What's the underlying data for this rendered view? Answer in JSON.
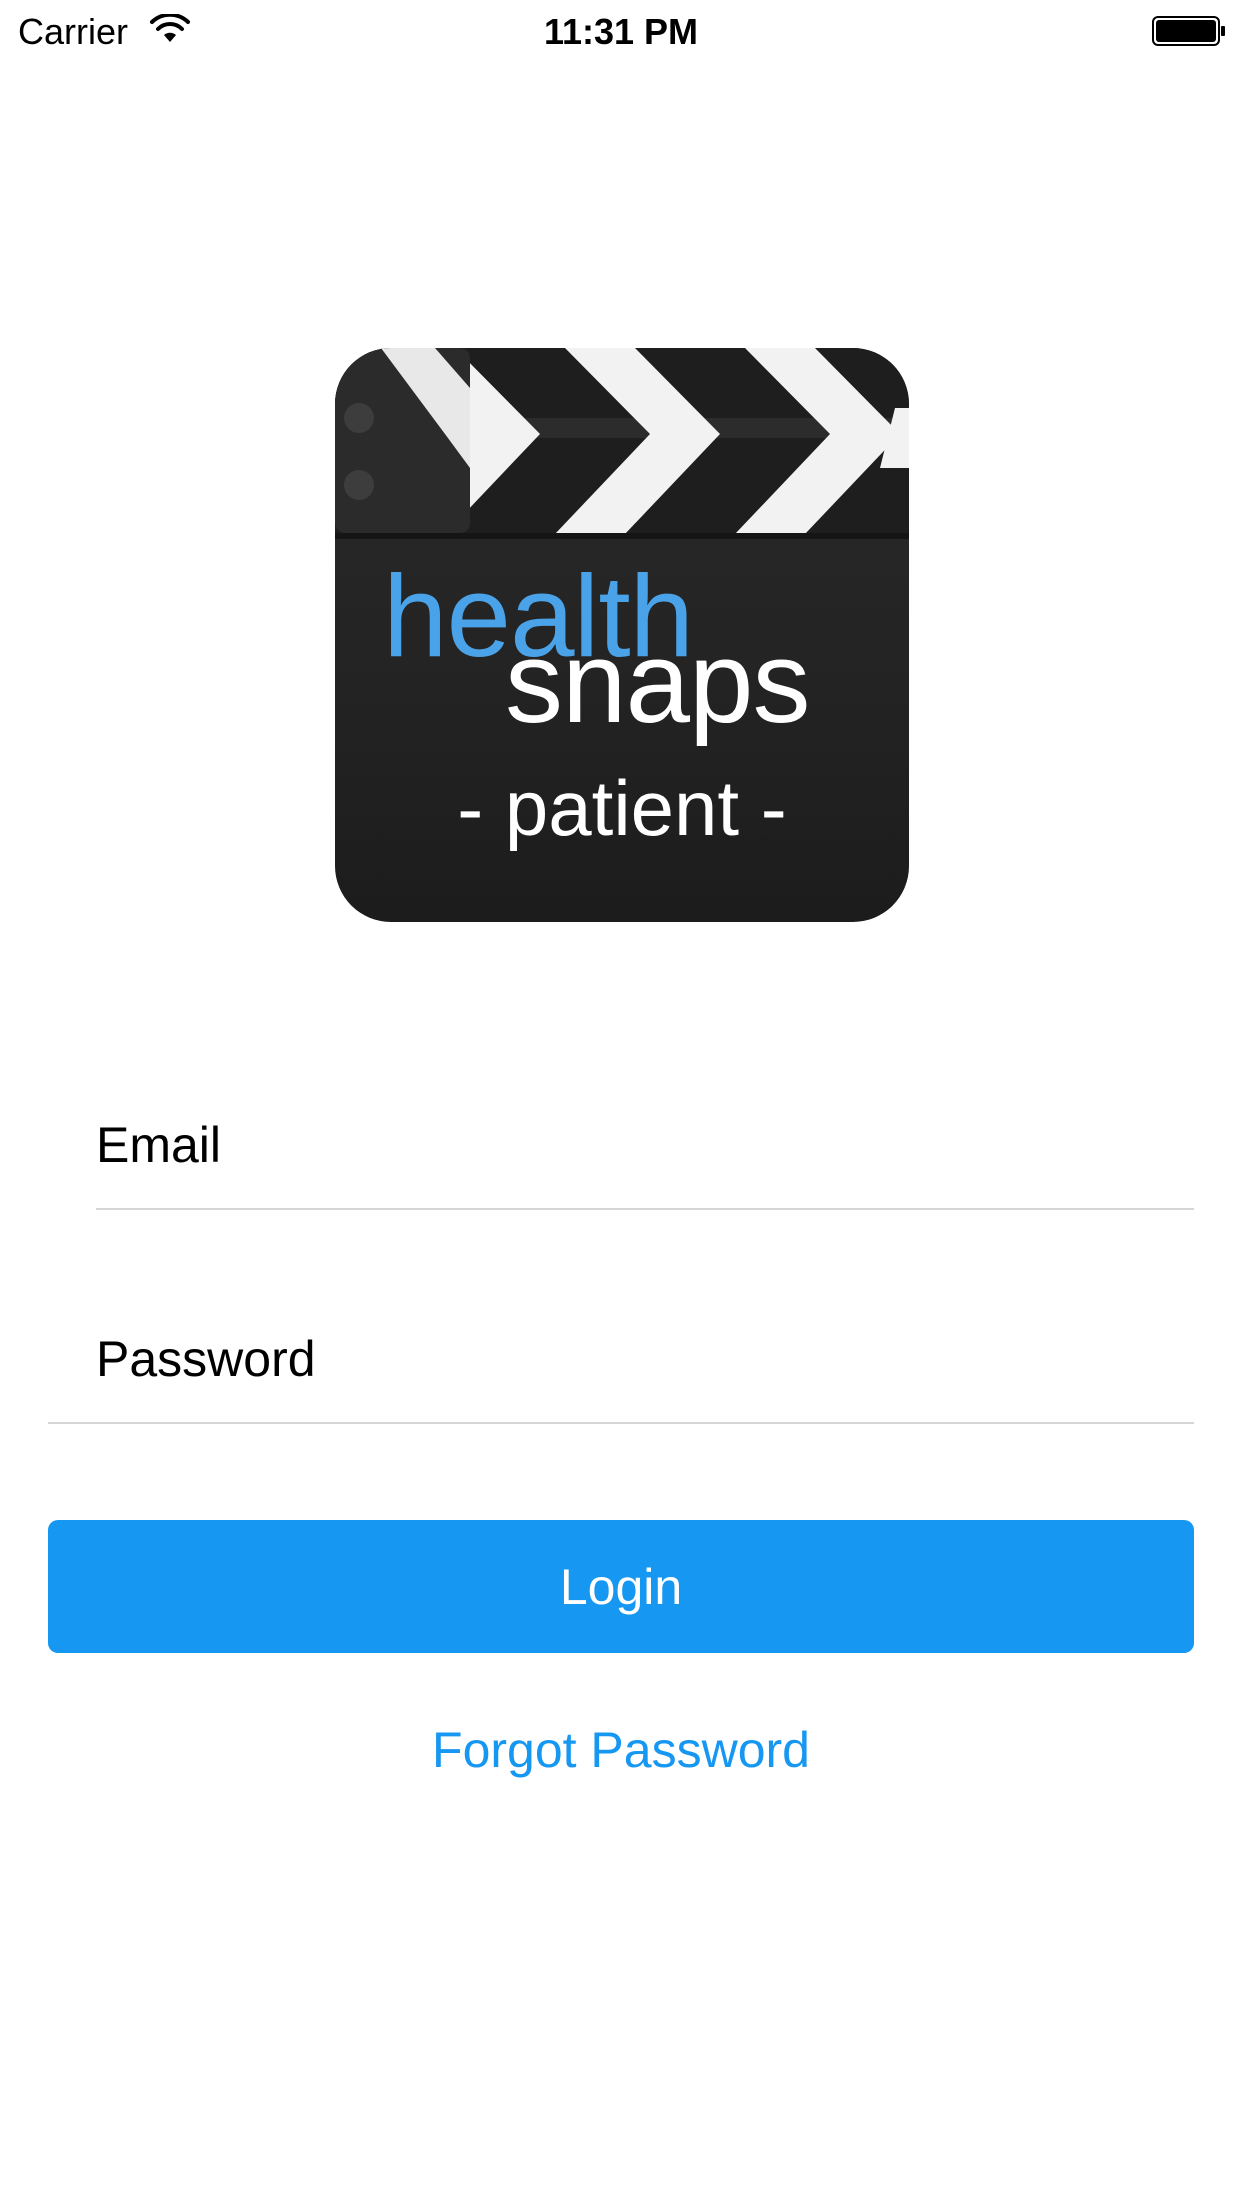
{
  "status_bar": {
    "carrier": "Carrier",
    "time": "11:31 PM",
    "wifi_icon": "wifi-icon",
    "battery_icon": "battery-icon"
  },
  "logo": {
    "lines": [
      "health",
      "snaps",
      "- patient -"
    ],
    "icon": "clapperboard-icon",
    "colors": {
      "health": "#4aa3e8",
      "snaps": "#ffffff",
      "background": "#232323"
    }
  },
  "form": {
    "email_placeholder": "Email",
    "email_value": "",
    "password_placeholder": "Password",
    "password_value": ""
  },
  "actions": {
    "login_label": "Login",
    "forgot_label": "Forgot Password"
  },
  "theme": {
    "accent": "#1597f2"
  }
}
